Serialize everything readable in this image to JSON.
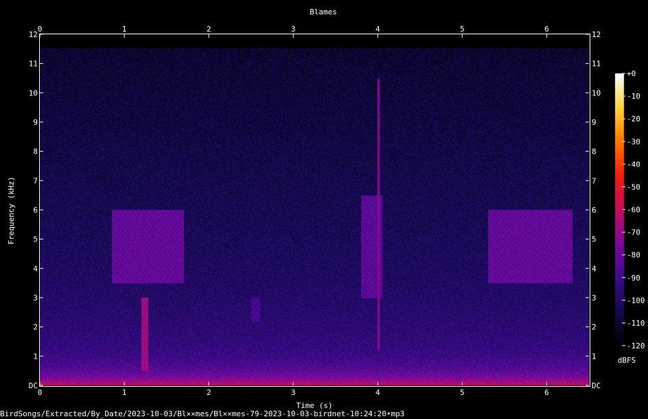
{
  "chart_data": {
    "type": "heatmap",
    "title": "Blames",
    "xlabel": "Time (s)",
    "ylabel": "Frequency (kHz)",
    "xlim": [
      0,
      6.5
    ],
    "ylim": [
      0,
      12
    ],
    "x_ticks": [
      "0",
      "1",
      "2",
      "3",
      "4",
      "5",
      "6"
    ],
    "y_ticks": [
      "DC",
      "1",
      "2",
      "3",
      "4",
      "5",
      "6",
      "7",
      "8",
      "9",
      "10",
      "11",
      "12"
    ],
    "colorbar": {
      "label": "dBFS",
      "ticks": [
        "+0",
        "-10",
        "-20",
        "-30",
        "-40",
        "-50",
        "-60",
        "-70",
        "-80",
        "-90",
        "-100",
        "-110",
        "-120"
      ],
      "range": [
        -120,
        0
      ],
      "colors": [
        "#000000",
        "#140a50",
        "#3c0a8c",
        "#7a0aa0",
        "#c0105a",
        "#f01e10",
        "#ff7800",
        "#ffd23c",
        "#ffffff"
      ]
    },
    "features": [
      {
        "t0": 0.85,
        "t1": 1.7,
        "f0": 3.5,
        "f1": 6.0,
        "level": -78
      },
      {
        "t0": 1.2,
        "t1": 1.28,
        "f0": 0.5,
        "f1": 3.0,
        "level": -65
      },
      {
        "t0": 2.5,
        "t1": 2.6,
        "f0": 2.2,
        "f1": 3.0,
        "level": -85
      },
      {
        "t0": 3.8,
        "t1": 4.05,
        "f0": 3.0,
        "f1": 6.5,
        "level": -80
      },
      {
        "t0": 3.99,
        "t1": 4.02,
        "f0": 1.2,
        "f1": 10.5,
        "level": -70
      },
      {
        "t0": 5.3,
        "t1": 6.3,
        "f0": 3.5,
        "f1": 6.0,
        "level": -78
      }
    ]
  },
  "footer": {
    "filename": "BirdSongs/Extracted/By_Date/2023-10-03/Bl××mes/Bl××mes-79-2023-10-03-birdnet-10:24:20•mp3"
  }
}
